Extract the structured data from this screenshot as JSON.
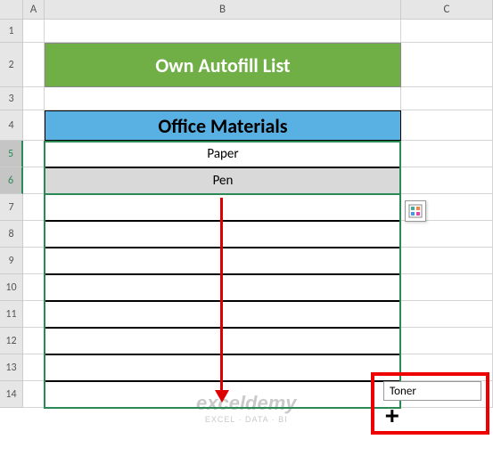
{
  "columns": {
    "A": "A",
    "B": "B",
    "C": "C"
  },
  "rows": {
    "r1": "1",
    "r2": "2",
    "r3": "3",
    "r4": "4",
    "r5": "5",
    "r6": "6",
    "r7": "7",
    "r8": "8",
    "r9": "9",
    "r10": "10",
    "r11": "11",
    "r12": "12",
    "r13": "13",
    "r14": "14"
  },
  "title": "Own Autofill List",
  "header": "Office Materials",
  "data": {
    "b5": "Paper",
    "b6": "Pen"
  },
  "tooltip": "Toner",
  "watermark": {
    "main": "exceldemy",
    "sub": "EXCEL · DATA · BI"
  },
  "chart_data": {
    "type": "table",
    "title": "Own Autofill List",
    "columns": [
      "Office Materials"
    ],
    "rows": [
      [
        "Paper"
      ],
      [
        "Pen"
      ]
    ],
    "autofill_preview": "Toner"
  }
}
